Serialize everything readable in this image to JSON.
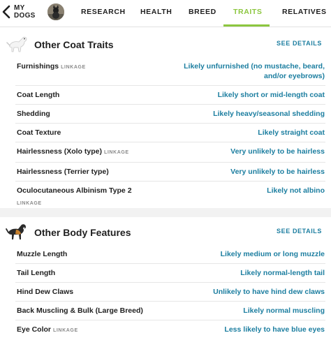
{
  "nav": {
    "back_label": "MY\nDOGS",
    "tabs": [
      {
        "label": "RESEARCH"
      },
      {
        "label": "HEALTH"
      },
      {
        "label": "BREED"
      },
      {
        "label": "TRAITS"
      },
      {
        "label": "RELATIVES"
      }
    ],
    "active_tab": "TRAITS",
    "accent_color": "#8cc63f"
  },
  "sections": [
    {
      "title": "Other Coat Traits",
      "icon": "dog-coat-icon",
      "see_details": "SEE DETAILS",
      "rows": [
        {
          "trait": "Furnishings",
          "linkage": "LINKAGE",
          "result": "Likely unfurnished (no mustache, beard, and/or eyebrows)"
        },
        {
          "trait": "Coat Length",
          "result": "Likely short or mid-length coat"
        },
        {
          "trait": "Shedding",
          "result": "Likely heavy/seasonal shedding"
        },
        {
          "trait": "Coat Texture",
          "result": "Likely straight coat"
        },
        {
          "trait": "Hairlessness (Xolo type)",
          "linkage": "LINKAGE",
          "result": "Very unlikely to be hairless"
        },
        {
          "trait": "Hairlessness (Terrier type)",
          "result": "Very unlikely to be hairless"
        },
        {
          "trait": "Oculocutaneous Albinism Type 2",
          "linkage": "LINKAGE",
          "result": "Likely not albino"
        }
      ]
    },
    {
      "title": "Other Body Features",
      "icon": "dog-body-icon",
      "see_details": "SEE DETAILS",
      "rows": [
        {
          "trait": "Muzzle Length",
          "result": "Likely medium or long muzzle"
        },
        {
          "trait": "Tail Length",
          "result": "Likely normal-length tail"
        },
        {
          "trait": "Hind Dew Claws",
          "result": "Unlikely to have hind dew claws"
        },
        {
          "trait": "Back Muscling & Bulk (Large Breed)",
          "result": "Likely normal muscling"
        },
        {
          "trait": "Eye Color",
          "linkage": "LINKAGE",
          "result": "Less likely to have blue eyes"
        }
      ]
    }
  ],
  "colors": {
    "link": "#1c7ea0",
    "text": "#1f1f1f",
    "muted": "#8a8a8a"
  }
}
